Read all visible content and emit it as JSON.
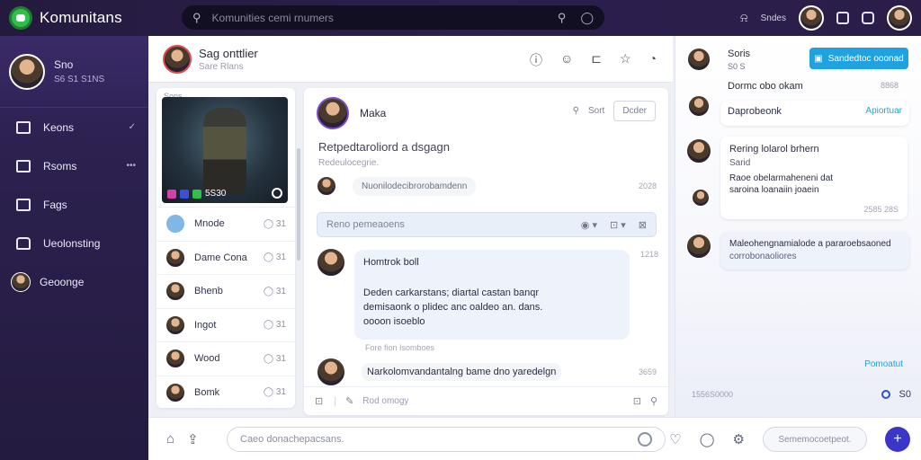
{
  "app": {
    "name": "Komunitans"
  },
  "search": {
    "placeholder": "Komunities cemi rnumers"
  },
  "topbar": {
    "label": "Sndes"
  },
  "user": {
    "name": "Sno",
    "sub": "S6 S1 S1NS"
  },
  "nav": [
    {
      "label": "Keons",
      "icon": "tag-icon"
    },
    {
      "label": "Rsoms",
      "icon": "window-icon"
    },
    {
      "label": "Fags",
      "icon": "flag-icon"
    },
    {
      "label": "Ueolonsting",
      "icon": "home-icon"
    },
    {
      "label": "Geoonge"
    }
  ],
  "channel": {
    "title": "Sag onttlier",
    "sub": "Sare Rlans"
  },
  "members": {
    "header": "Sons",
    "card_stat": "5S30",
    "list": [
      {
        "name": "Mnode",
        "count": "31"
      },
      {
        "name": "Dame Cona",
        "count": "31"
      },
      {
        "name": "Bhenb",
        "count": "31"
      },
      {
        "name": "Ingot",
        "count": "31"
      },
      {
        "name": "Wood",
        "count": "31"
      },
      {
        "name": "Bomk",
        "count": "31"
      }
    ]
  },
  "post": {
    "author": "Maka",
    "action_label": "Sort",
    "follow_label": "Dcder",
    "title": "Retpedtaroliord a dsgagn",
    "subtitle": "Redeulocegrie.",
    "reply": {
      "text": "Nuonilodecibrorobamdenn",
      "time": "2028"
    },
    "composer_placeholder": "Reno pemeaoens",
    "message": {
      "author": "Homtrok boll",
      "body_line1": "Deden carkarstans; diartal castan banqr",
      "body_line2": "demisaonk o plidec anc oaldeo an. dans.",
      "body_line3": "oooon isoeblo",
      "time": "1218"
    },
    "meta": "Fore fion Isomboes",
    "message2": {
      "text": "Narkolomvandantalng bame dno yaredelgn",
      "time": "3659"
    },
    "footer_placeholder": "Rod omogy"
  },
  "right_panel": {
    "user": {
      "name": "Soris",
      "sub": "S0 S"
    },
    "button_label": "Sandedtoc ooonad",
    "line": {
      "text": "Dormc obo okam",
      "time": "8868"
    },
    "card1": {
      "text": "Daprobeonk",
      "link": "Apiortuar"
    },
    "card2": {
      "title": "Rering lolarol brhern",
      "sub1": "Sarid",
      "sub2": "Raoe obelarmaheneni dat",
      "sub3": "saroina loanaiin joaein",
      "time": "2585 28S"
    },
    "card3": {
      "line1": "Maleohengnamialode a pararoebsaoned",
      "line2": "corrobonaoliores"
    },
    "link": "Pomoatut",
    "footer": {
      "text": "1556S0000",
      "count": "S0"
    }
  },
  "bottom": {
    "input_placeholder": "Caeo donachepacsans.",
    "pill_label": "Sememocoetpeot."
  },
  "colors": {
    "accent": "#1fa3e0",
    "sidebar": "#2c2150",
    "send": "#3c36c8",
    "online": "#2fbf4a"
  }
}
